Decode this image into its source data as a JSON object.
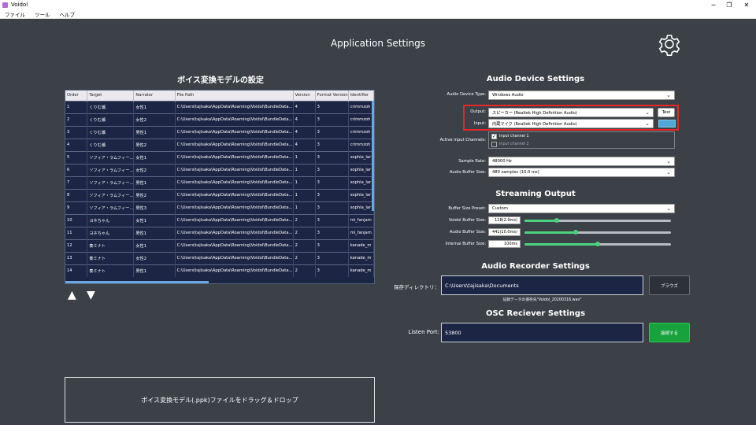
{
  "window": {
    "title": "Voidol",
    "minimize": "─",
    "restore": "❐",
    "close": "✕"
  },
  "menu": [
    "ファイル",
    "ツール",
    "ヘルプ"
  ],
  "app_title": "Application Settings",
  "left": {
    "title": "ボイス変換モデルの設定",
    "columns": [
      "Order",
      "Target",
      "Narrator",
      "File Path",
      "Version",
      "Format Version",
      "Identifier"
    ],
    "rows": [
      [
        "1",
        "くりむ瀬",
        "女性1",
        "C:\\Users\\tajisaka\\AppData\\Roaming\\Voidol\\BundleData...",
        "4",
        "3",
        "crimmzoh"
      ],
      [
        "2",
        "くりむ瀬",
        "女性2",
        "C:\\Users\\tajisaka\\AppData\\Roaming\\Voidol\\BundleData...",
        "4",
        "3",
        "crimmzoh"
      ],
      [
        "3",
        "くりむ瀬",
        "男性1",
        "C:\\Users\\tajisaka\\AppData\\Roaming\\Voidol\\BundleData...",
        "4",
        "3",
        "crimmzoh"
      ],
      [
        "4",
        "くりむ瀬",
        "男性2",
        "C:\\Users\\tajisaka\\AppData\\Roaming\\Voidol\\BundleData...",
        "4",
        "3",
        "crimmzoh"
      ],
      [
        "5",
        "ソフィア・ラムフィー...",
        "女性1",
        "C:\\Users\\tajisaka\\AppData\\Roaming\\Voidol\\BundleData...",
        "1",
        "3",
        "sophia_lar"
      ],
      [
        "6",
        "ソフィア・ラムフィー...",
        "女性2",
        "C:\\Users\\tajisaka\\AppData\\Roaming\\Voidol\\BundleData...",
        "1",
        "3",
        "sophia_lar"
      ],
      [
        "7",
        "ソフィア・ラムフィー...",
        "男性1",
        "C:\\Users\\tajisaka\\AppData\\Roaming\\Voidol\\BundleData...",
        "1",
        "3",
        "sophia_lar"
      ],
      [
        "8",
        "ソフィア・ラムフィー...",
        "男性2",
        "C:\\Users\\tajisaka\\AppData\\Roaming\\Voidol\\BundleData...",
        "1",
        "3",
        "sophia_lar"
      ],
      [
        "9",
        "ソフィア・ラムフィー...",
        "男性3",
        "C:\\Users\\tajisaka\\AppData\\Roaming\\Voidol\\BundleData...",
        "1",
        "3",
        "sophia_lar"
      ],
      [
        "10",
        "ヨネちゃん",
        "女性1",
        "C:\\Users\\tajisaka\\AppData\\Roaming\\Voidol\\BundleData...",
        "2",
        "3",
        "mi_fanjam"
      ],
      [
        "11",
        "ヨネちゃん",
        "男性1",
        "C:\\Users\\tajisaka\\AppData\\Roaming\\Voidol\\BundleData...",
        "2",
        "3",
        "mi_fanjam"
      ],
      [
        "12",
        "奏ミナト",
        "女性1",
        "C:\\Users\\tajisaka\\AppData\\Roaming\\Voidol\\BundleData...",
        "2",
        "3",
        "kanade_m"
      ],
      [
        "13",
        "奏ミナト",
        "女性2",
        "C:\\Users\\tajisaka\\AppData\\Roaming\\Voidol\\BundleData...",
        "2",
        "3",
        "kanade_m"
      ],
      [
        "14",
        "奏ミナト",
        "男性1",
        "C:\\Users\\tajisaka\\AppData\\Roaming\\Voidol\\BundleData...",
        "2",
        "3",
        "kanade_m"
      ]
    ],
    "up_arrow": "▲",
    "down_arrow": "▼",
    "drop_zone": "ボイス変換モデル(.ppk)ファイルをドラッグ＆ドロップ"
  },
  "audio_device": {
    "title": "Audio Device Settings",
    "device_type_label": "Audio Device Type:",
    "device_type_value": "Windows Audio",
    "output_label": "Output:",
    "output_value": "スピーカー (Realtek High Definition Audio)",
    "test_button": "Test",
    "input_label": "Input:",
    "input_value": "内蔵マイク (Realtek High Definition Audio)",
    "active_channels_label": "Active input Channels:",
    "channel1": "Input channel 1",
    "channel2": "Input channel 2",
    "sample_rate_label": "Sample Rate:",
    "sample_rate_value": "48000 Hz",
    "buffer_size_label": "Audio Buffer Size:",
    "buffer_size_value": "480 samples (10.0 ms)"
  },
  "streaming": {
    "title": "Streaming Output",
    "preset_label": "Buffer Size Preset:",
    "preset_value": "Custom",
    "voidol_label": "Voidol Buffer Size:",
    "voidol_value": "128(2.9ms)",
    "voidol_level": 0.22,
    "audio_label": "Audio Buffer Size:",
    "audio_value": "441(10.0ms)",
    "audio_level": 0.35,
    "internal_label": "Internal Buffer Size:",
    "internal_value": "100ms",
    "internal_level": 0.5
  },
  "recorder": {
    "title": "Audio Recorder Settings",
    "dir_label": "保存ディレクトリ：",
    "dir_value": "C:\\Users\\tajisaka\\Documents",
    "browse_button": "ブラウズ",
    "note": "記録データの保存先\"Voidol_20200316.wav\""
  },
  "osc": {
    "title": "OSC Reciever Settings",
    "port_label": "Listen Port:",
    "port_value": "53800",
    "connect_button": "接続する"
  },
  "colors": {
    "accent_green": "#4cd27e",
    "highlight_red": "#e52727",
    "panel_dark": "#1c2544"
  }
}
